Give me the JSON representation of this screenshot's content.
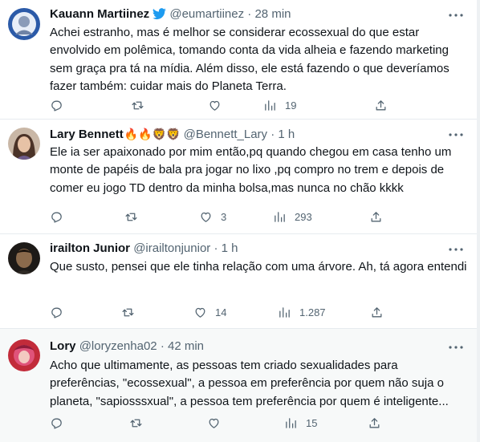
{
  "tweets": [
    {
      "name": "Kauann Martiinez",
      "handle": "@eumartiinez",
      "time": "28 min",
      "text": "Achei estranho, mas é melhor se considerar ecossexual do que estar envolvido em polêmica, tomando conta da vida alheia e fazendo marketing sem graça pra tá na mídia. Além disso, ele está fazendo o que deveríamos fazer também: cuidar mais do Planeta Terra.",
      "replies": "",
      "retweets": "",
      "likes": "",
      "views": "19",
      "verified": true
    },
    {
      "name": "Lary Bennett",
      "name_emoji": "🔥🔥🦁🦁",
      "handle": "@Bennett_Lary",
      "time": "1 h",
      "text": "Ele ia ser apaixonado por mim então,pq quando chegou em casa tenho um monte de papéis de bala pra jogar no lixo ,pq compro no trem e depois de comer eu jogo TD dentro da minha bolsa,mas nunca no chão kkkk",
      "replies": "",
      "retweets": "",
      "likes": "3",
      "views": "293"
    },
    {
      "name": "irailton Junior",
      "handle": "@irailtonjunior",
      "time": "1 h",
      "text": "Que susto, pensei que ele tinha relação com uma árvore. Ah, tá agora entendi",
      "replies": "",
      "retweets": "",
      "likes": "14",
      "views": "1.287"
    },
    {
      "name": "Lory",
      "handle": "@loryzenha02",
      "time": "42 min",
      "text": "Acho que ultimamente, as pessoas tem criado sexualidades para preferências, \"ecossexual\", a pessoa em preferência por quem não suja o planeta, \"sapiosssxual\", a pessoa tem preferência por quem é inteligente...",
      "replies": "",
      "retweets": "",
      "likes": "",
      "views": "15"
    }
  ],
  "icons": [
    "reply-icon",
    "retweet-icon",
    "like-icon",
    "views-icon",
    "share-icon",
    "more-icon",
    "verified-icon"
  ],
  "colors": {
    "text": "#0f1419",
    "muted": "#536471",
    "border": "#eff3f4",
    "highlight_bg": "#f7f9f9"
  }
}
